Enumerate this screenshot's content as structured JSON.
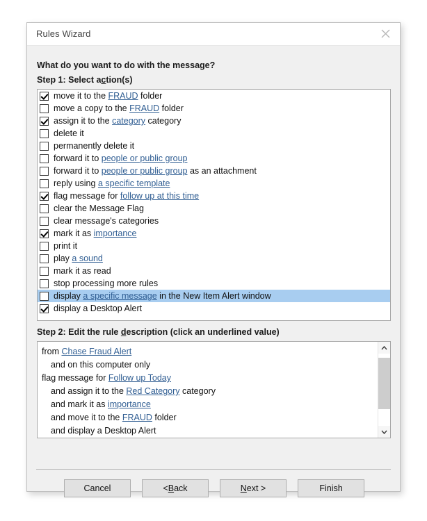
{
  "window": {
    "title": "Rules Wizard",
    "close_icon": "close-icon"
  },
  "main": {
    "question_pre": "What do you want to do with the message",
    "question_acc": "",
    "question": "What do you want to do with the message?",
    "step1": {
      "label_pre": "Step 1: Select a",
      "label_acc": "c",
      "label_post": "tion(s)",
      "actions": [
        {
          "checked": true,
          "selected": false,
          "parts": [
            {
              "t": "move it to the ",
              "link": false
            },
            {
              "t": "FRAUD",
              "link": true
            },
            {
              "t": " folder",
              "link": false
            }
          ]
        },
        {
          "checked": false,
          "selected": false,
          "parts": [
            {
              "t": "move a copy to the ",
              "link": false
            },
            {
              "t": "FRAUD",
              "link": true
            },
            {
              "t": " folder",
              "link": false
            }
          ]
        },
        {
          "checked": true,
          "selected": false,
          "parts": [
            {
              "t": "assign it to the ",
              "link": false
            },
            {
              "t": "category",
              "link": true
            },
            {
              "t": " category",
              "link": false
            }
          ]
        },
        {
          "checked": false,
          "selected": false,
          "parts": [
            {
              "t": "delete it",
              "link": false
            }
          ]
        },
        {
          "checked": false,
          "selected": false,
          "parts": [
            {
              "t": "permanently delete it",
              "link": false
            }
          ]
        },
        {
          "checked": false,
          "selected": false,
          "parts": [
            {
              "t": "forward it to ",
              "link": false
            },
            {
              "t": "people or public group",
              "link": true
            }
          ]
        },
        {
          "checked": false,
          "selected": false,
          "parts": [
            {
              "t": "forward it to ",
              "link": false
            },
            {
              "t": "people or public group",
              "link": true
            },
            {
              "t": " as an attachment",
              "link": false
            }
          ]
        },
        {
          "checked": false,
          "selected": false,
          "parts": [
            {
              "t": "reply using ",
              "link": false
            },
            {
              "t": "a specific template",
              "link": true
            }
          ]
        },
        {
          "checked": true,
          "selected": false,
          "parts": [
            {
              "t": "flag message for ",
              "link": false
            },
            {
              "t": "follow up at this time",
              "link": true
            }
          ]
        },
        {
          "checked": false,
          "selected": false,
          "parts": [
            {
              "t": "clear the Message Flag",
              "link": false
            }
          ]
        },
        {
          "checked": false,
          "selected": false,
          "parts": [
            {
              "t": "clear message's categories",
              "link": false
            }
          ]
        },
        {
          "checked": true,
          "selected": false,
          "parts": [
            {
              "t": "mark it as ",
              "link": false
            },
            {
              "t": "importance",
              "link": true
            }
          ]
        },
        {
          "checked": false,
          "selected": false,
          "parts": [
            {
              "t": "print it",
              "link": false
            }
          ]
        },
        {
          "checked": false,
          "selected": false,
          "parts": [
            {
              "t": "play ",
              "link": false
            },
            {
              "t": "a sound",
              "link": true
            }
          ]
        },
        {
          "checked": false,
          "selected": false,
          "parts": [
            {
              "t": "mark it as read",
              "link": false
            }
          ]
        },
        {
          "checked": false,
          "selected": false,
          "parts": [
            {
              "t": "stop processing more rules",
              "link": false
            }
          ]
        },
        {
          "checked": false,
          "selected": true,
          "parts": [
            {
              "t": "display ",
              "link": false
            },
            {
              "t": "a specific message",
              "link": true
            },
            {
              "t": " in the New Item Alert window",
              "link": false
            }
          ]
        },
        {
          "checked": true,
          "selected": false,
          "parts": [
            {
              "t": "display a Desktop Alert",
              "link": false
            }
          ]
        }
      ]
    },
    "step2": {
      "label_pre": "Step 2: Edit the rule ",
      "label_acc": "d",
      "label_post": "escription (click an underlined value)",
      "description_lines": [
        {
          "indent": false,
          "parts": [
            {
              "t": "from ",
              "link": false
            },
            {
              "t": "Chase Fraud Alert",
              "link": true
            }
          ]
        },
        {
          "indent": true,
          "parts": [
            {
              "t": "and on this computer only",
              "link": false
            }
          ]
        },
        {
          "indent": false,
          "parts": [
            {
              "t": "flag message for ",
              "link": false
            },
            {
              "t": "Follow up Today",
              "link": true
            }
          ]
        },
        {
          "indent": true,
          "parts": [
            {
              "t": "and assign it to the ",
              "link": false
            },
            {
              "t": "Red Category",
              "link": true
            },
            {
              "t": " category",
              "link": false
            }
          ]
        },
        {
          "indent": true,
          "parts": [
            {
              "t": "and mark it as ",
              "link": false
            },
            {
              "t": "importance",
              "link": true
            }
          ]
        },
        {
          "indent": true,
          "parts": [
            {
              "t": "and move it to the ",
              "link": false
            },
            {
              "t": "FRAUD",
              "link": true
            },
            {
              "t": " folder",
              "link": false
            }
          ]
        },
        {
          "indent": true,
          "parts": [
            {
              "t": "and display a Desktop Alert",
              "link": false
            }
          ]
        }
      ],
      "scrollbar": {
        "up_icon": "chevron-up-icon",
        "down_icon": "chevron-down-icon"
      }
    }
  },
  "footer": {
    "buttons": [
      {
        "name": "cancel-button",
        "pre": "Cancel",
        "acc": "",
        "post": ""
      },
      {
        "name": "back-button",
        "pre": "< ",
        "acc": "B",
        "post": "ack"
      },
      {
        "name": "next-button",
        "pre": "",
        "acc": "N",
        "post": "ext >"
      },
      {
        "name": "finish-button",
        "pre": "Finish",
        "acc": "",
        "post": ""
      }
    ]
  },
  "colors": {
    "dialog_bg": "#f0f0f0",
    "selection": "#a8cdf0",
    "link": "#2f5d92",
    "button_bg": "#e1e1e1"
  }
}
